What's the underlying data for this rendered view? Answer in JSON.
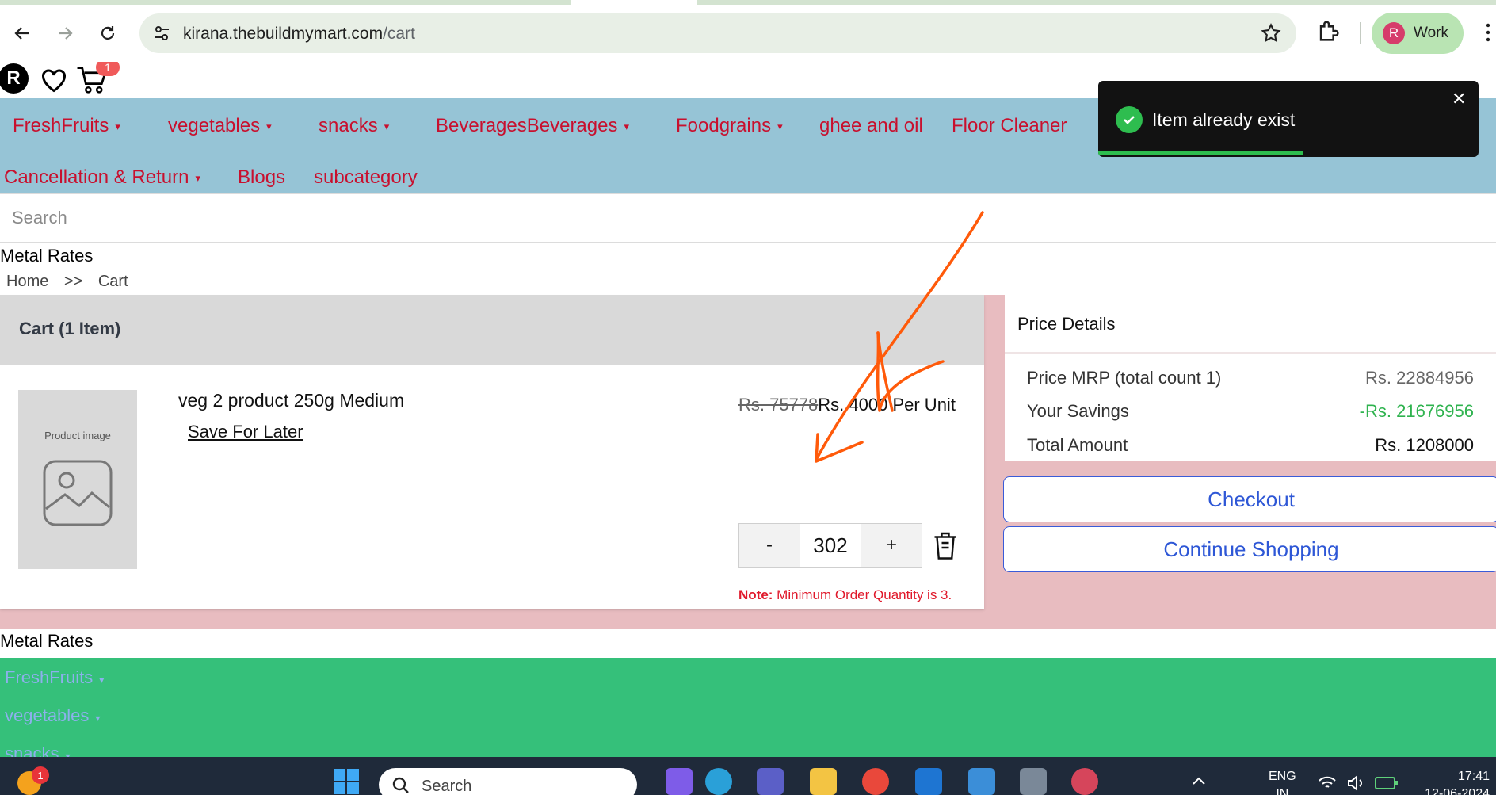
{
  "browser": {
    "url_host": "kirana.thebuildmymart.com",
    "url_path": "/cart",
    "profile_initial": "R",
    "profile_label": "Work"
  },
  "header": {
    "user_initial": "R",
    "cart_count": "1"
  },
  "nav": {
    "items": [
      {
        "label": "FreshFruits",
        "dropdown": true
      },
      {
        "label": "vegetables",
        "dropdown": true
      },
      {
        "label": "snacks",
        "dropdown": true
      },
      {
        "label": "BeveragesBeverages",
        "dropdown": true
      },
      {
        "label": "Foodgrains",
        "dropdown": true
      },
      {
        "label": "ghee and oil",
        "dropdown": false
      },
      {
        "label": "Floor Cleaner",
        "dropdown": false
      },
      {
        "label": "Cancellation & Return",
        "dropdown": true
      },
      {
        "label": "Blogs",
        "dropdown": false
      },
      {
        "label": "subcategory",
        "dropdown": false
      }
    ],
    "caret": "▾"
  },
  "search": {
    "placeholder": "Search"
  },
  "metal_rates_label": "Metal Rates",
  "breadcrumb": {
    "home": "Home",
    "separator": ">>",
    "current": "Cart"
  },
  "cart": {
    "title": "Cart (1 Item)",
    "product": {
      "image_placeholder": "Product image",
      "name": "veg 2 product 250g Medium",
      "save_for_later": "Save For Later",
      "mrp": "Rs. 75778",
      "price": "Rs. 4000 Per Unit",
      "quantity": "302",
      "decrement": "-",
      "increment": "+",
      "note_label": "Note:",
      "note_text": " Minimum Order Quantity is 3."
    }
  },
  "price_details": {
    "title": "Price Details",
    "rows": [
      {
        "label": "Price MRP (total count 1)",
        "value": "Rs. 22884956"
      },
      {
        "label": "Your Savings",
        "value": "-Rs. 21676956"
      },
      {
        "label": "Total Amount",
        "value": "Rs. 1208000"
      }
    ],
    "checkout": "Checkout",
    "continue_shopping": "Continue Shopping"
  },
  "footer": {
    "metal_rates": "Metal Rates",
    "links": [
      "FreshFruits",
      "vegetables",
      "snacks"
    ]
  },
  "toast": {
    "message": "Item already exist",
    "close": "✕",
    "progress": 0.54
  },
  "taskbar": {
    "search_label": "Search",
    "notification_count": "1",
    "lang_primary": "ENG",
    "lang_secondary": "IN",
    "time": "17:41",
    "date": "12-06-2024"
  },
  "colors": {
    "nav_bg": "#96c4d6",
    "nav_text": "#c8102e",
    "cart_area_bg": "#e8bcc0",
    "savings_green": "#2fb34f",
    "button_blue": "#2e57d6",
    "footer_green": "#35c07a",
    "annotation_orange": "#ff5a0a"
  }
}
